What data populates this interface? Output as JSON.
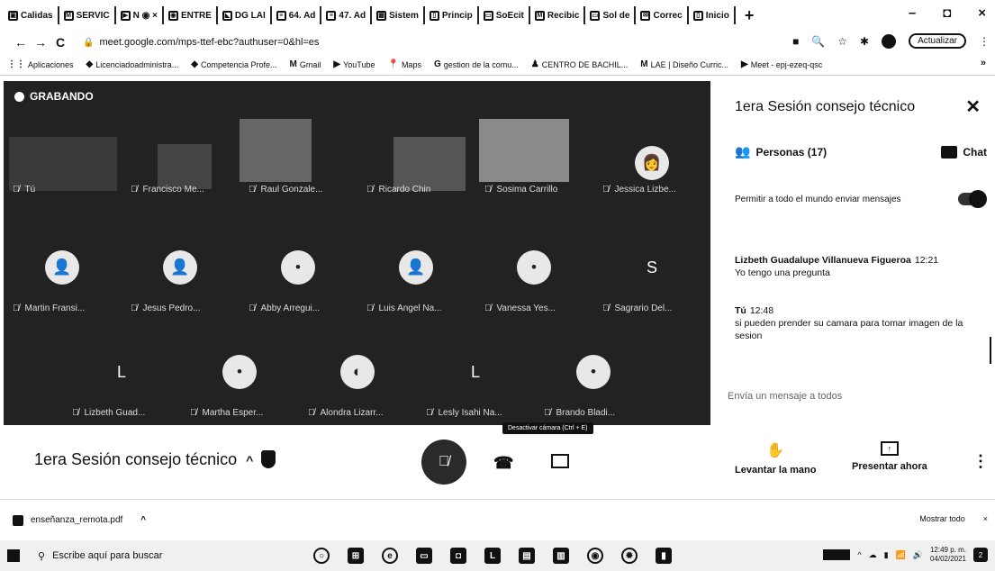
{
  "browser": {
    "tabs": [
      {
        "icon": "image-icon",
        "label": "Calidas"
      },
      {
        "icon": "gmail-icon",
        "label": "SERVIC"
      },
      {
        "icon": "meet-icon",
        "label": "N ◉ ×"
      },
      {
        "icon": "chrome-icon",
        "label": "ENTRE"
      },
      {
        "icon": "classroom-icon",
        "label": "DG LAI"
      },
      {
        "icon": "sheets-icon",
        "label": "64. Ad"
      },
      {
        "icon": "sheets-icon",
        "label": "47. Ad"
      },
      {
        "icon": "calendar-icon",
        "label": "Sistem"
      },
      {
        "icon": "page-icon",
        "label": "Princip"
      },
      {
        "icon": "slides-icon",
        "label": "SoEcit"
      },
      {
        "icon": "gmail-icon",
        "label": "Recibic"
      },
      {
        "icon": "slides-icon",
        "label": "Sol de"
      },
      {
        "icon": "mail-icon",
        "label": "Correc"
      },
      {
        "icon": "page-icon",
        "label": "Inicio"
      }
    ],
    "new_tab": "+",
    "window_controls": {
      "minimize": "–",
      "maximize": "◘",
      "close": "×"
    },
    "address": {
      "back": "←",
      "forward": "→",
      "reload": "C",
      "url": "meet.google.com/mps-ttef-ebc?authuser=0&hl=es",
      "update_label": "Actualizar"
    },
    "bookmarks": [
      {
        "icon": "apps-icon",
        "label": "Aplicaciones"
      },
      {
        "icon": "bookmark-icon",
        "label": "Licenciadoadministra..."
      },
      {
        "icon": "bookmark-icon",
        "label": "Competencia Profe..."
      },
      {
        "icon": "gmail-icon",
        "label": "Gmail"
      },
      {
        "icon": "youtube-icon",
        "label": "YouTube"
      },
      {
        "icon": "maps-icon",
        "label": "Maps"
      },
      {
        "icon": "google-icon",
        "label": "gestion de la comu..."
      },
      {
        "icon": "person-icon",
        "label": "CENTRO DE BACHIL..."
      },
      {
        "icon": "gmail-icon",
        "label": "LAE | Diseño Curric..."
      },
      {
        "icon": "meet-icon",
        "label": "Meet - epj-ezeq-qsc"
      }
    ],
    "bookmarks_more": "»"
  },
  "meet": {
    "recording_label": "GRABANDO",
    "participants": [
      {
        "name": "Tú",
        "avatar": "",
        "video": true
      },
      {
        "name": "Francisco Me...",
        "avatar": "",
        "video": true
      },
      {
        "name": "Raul Gonzale...",
        "avatar": "",
        "video": true
      },
      {
        "name": "Ricardo Chin",
        "avatar": "",
        "video": true
      },
      {
        "name": "Sosima Carrillo",
        "avatar": "",
        "video": true
      },
      {
        "name": "Jessica Lizbe...",
        "avatar": "👩",
        "video": false
      },
      {
        "name": "Martin Fransi...",
        "avatar": "👤",
        "video": false
      },
      {
        "name": "Jesus Pedro...",
        "avatar": "👤",
        "video": false
      },
      {
        "name": "Abby Arregui...",
        "avatar": "•",
        "video": false
      },
      {
        "name": "Luis Angel Na...",
        "avatar": "👤",
        "video": false
      },
      {
        "name": "Vanessa Yes...",
        "avatar": "•",
        "video": false
      },
      {
        "name": "Sagrario Del...",
        "avatar": "S",
        "video": false
      },
      {
        "name": "Lizbeth Guad...",
        "avatar": "L",
        "video": false
      },
      {
        "name": "Martha Esper...",
        "avatar": "•",
        "video": false
      },
      {
        "name": "Alondra Lizarr...",
        "avatar": "◐",
        "video": false
      },
      {
        "name": "Lesly Isahi Na...",
        "avatar": "L",
        "video": false
      },
      {
        "name": "Brando Bladi...",
        "avatar": "•",
        "video": false
      }
    ],
    "panel": {
      "title": "1era Sesión consejo técnico",
      "close": "✕",
      "people_tab": "Personas (17)",
      "chat_tab": "Chat",
      "allow_messages": "Permitir a todo el mundo enviar mensajes",
      "messages": [
        {
          "sender": "Lizbeth Guadalupe Villanueva Figueroa",
          "time": "12:21",
          "text": "Yo tengo una pregunta"
        },
        {
          "sender": "Tú",
          "time": "12:48",
          "text": "si pueden prender su camara para tomar imagen de la sesion"
        }
      ],
      "input_placeholder": "Envía un mensaje a todos"
    },
    "bottom": {
      "meeting_title": "1era Sesión consejo técnico",
      "title_chevron": "^",
      "tooltip": "Desactivar cámara (Ctrl + E)",
      "raise_hand": "Levantar la mano",
      "present_now": "Presentar ahora",
      "more": "⋮"
    }
  },
  "downloads": {
    "file_name": "enseñanza_remota.pdf",
    "show_all": "Mostrar todo",
    "close": "×"
  },
  "taskbar": {
    "search_placeholder": "Escribe aquí para buscar",
    "time": "12:49 p. m.",
    "date": "04/02/2021",
    "notifications": "2"
  }
}
